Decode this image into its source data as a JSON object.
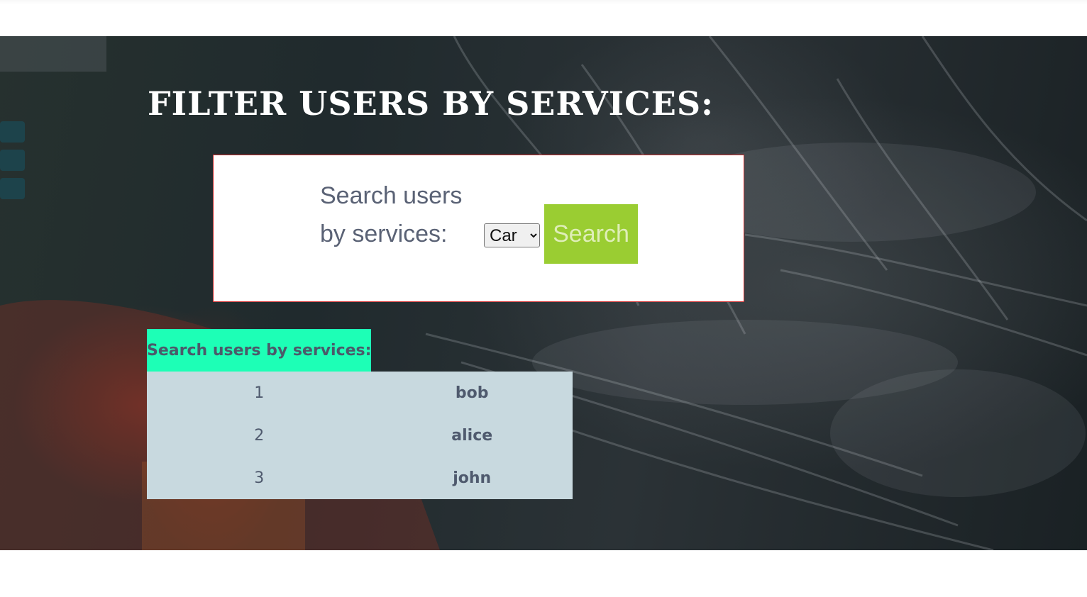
{
  "page": {
    "title": "FILTER USERS BY SERVICES:"
  },
  "search_form": {
    "label": "Search users by services:",
    "select_value": "Car",
    "button_label": "Search"
  },
  "results_table": {
    "header": "Search users by services:",
    "rows": [
      {
        "id": "1",
        "name": "bob"
      },
      {
        "id": "2",
        "name": "alice"
      },
      {
        "id": "3",
        "name": "john"
      }
    ]
  },
  "colors": {
    "button": "#9acd32",
    "table_header": "#1dffb6",
    "table_body": "#c8d9df",
    "card_border": "#d32f2f"
  }
}
